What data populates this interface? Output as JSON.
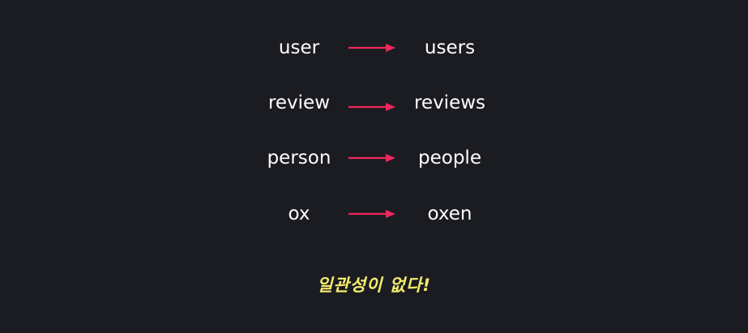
{
  "rows": [
    {
      "singular": "user",
      "plural": "users"
    },
    {
      "singular": "review",
      "plural": "reviews"
    },
    {
      "singular": "person",
      "plural": "people"
    },
    {
      "singular": "ox",
      "plural": "oxen"
    }
  ],
  "caption": "일관성이 없다!",
  "colors": {
    "background": "#1b1c21",
    "text": "#ffffff",
    "arrow": "#f0285c",
    "caption": "#f4ec6e"
  },
  "icons": {
    "arrow": "right-arrow-icon"
  }
}
